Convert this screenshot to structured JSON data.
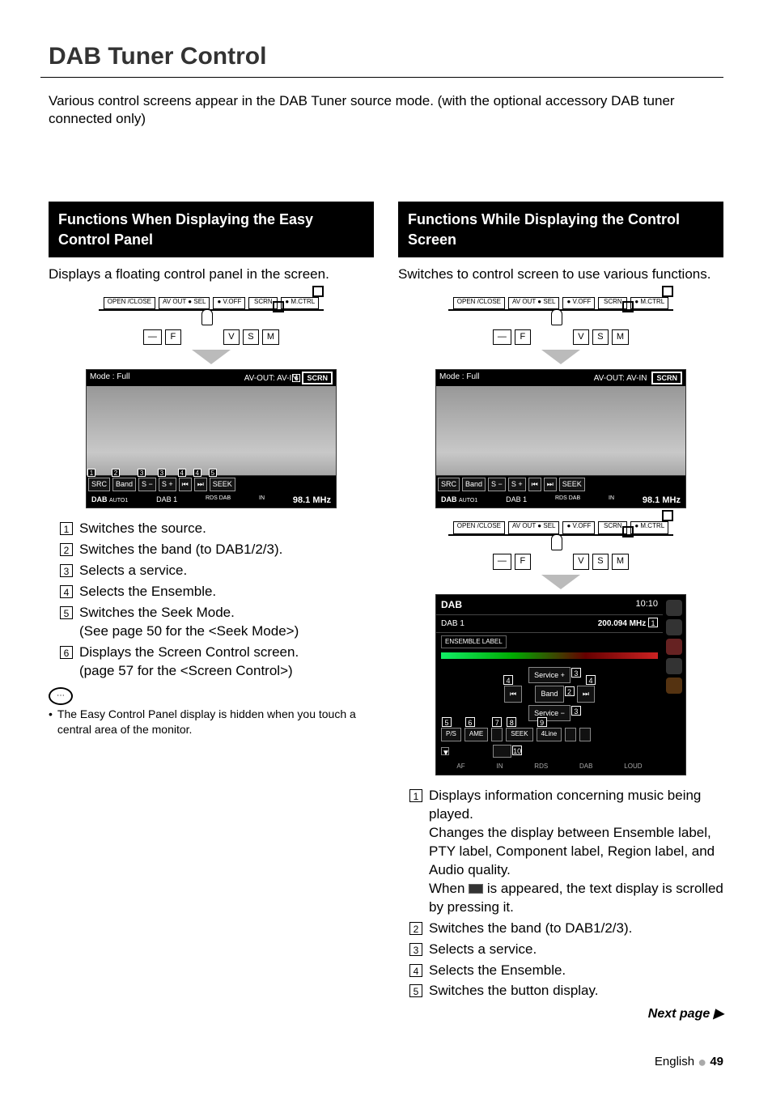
{
  "page": {
    "title": "DAB Tuner Control",
    "intro": "Various control screens appear in the DAB Tuner source mode. (with the optional accessory DAB tuner connected only)",
    "language": "English",
    "number": "49",
    "next_page": "Next page ▶"
  },
  "left": {
    "heading": "Functions When Displaying the Easy Control Panel",
    "desc": "Displays a floating control panel in the screen.",
    "buttons": {
      "open_close": "OPEN\n/CLOSE",
      "av_out_sel": "AV OUT\n● SEL",
      "v_off": "● V.OFF",
      "scrn": "SCRN",
      "mctrl": "● M.CTRL",
      "dash": "—",
      "f": "F",
      "v": "V",
      "s": "S",
      "m": "M"
    },
    "shot": {
      "mode": "Mode : Full",
      "avout": "AV-OUT: AV-IN",
      "scrn": "SCRN",
      "scrn_callout": "6",
      "bar": {
        "src": "SRC",
        "band": "Band",
        "sminus": "S −",
        "splus": "S +",
        "prev": "⏮",
        "next": "⏭",
        "seek": "SEEK",
        "callouts": {
          "src": "1",
          "band": "2",
          "sminus": "3",
          "splus": "3",
          "prev": "4",
          "next": "4",
          "seek": "5"
        }
      },
      "info": {
        "src": "DAB",
        "auto": "AUTO1",
        "preset": "DAB 1",
        "rds": "RDS",
        "dab": "DAB",
        "in": "IN",
        "freq": "98.1 MHz"
      }
    },
    "items": [
      "Switches the source.",
      "Switches the band (to DAB1/2/3).",
      "Selects a service.",
      "Selects the Ensemble.",
      "Switches the Seek Mode.",
      "Displays the Screen Control screen."
    ],
    "subs": {
      "5": "(See page 50 for the <Seek Mode>)",
      "6": "(page 57 for the <Screen Control>)"
    },
    "note_bullet": "•",
    "note": "The Easy Control Panel display is hidden when you touch a central area of the monitor."
  },
  "right": {
    "heading": "Functions While Displaying the Control Screen",
    "desc": "Switches to control screen to use various functions.",
    "buttons": {
      "open_close": "OPEN\n/CLOSE",
      "av_out_sel": "AV OUT\n● SEL",
      "v_off": "● V.OFF",
      "scrn": "SCRN",
      "mctrl": "● M.CTRL",
      "dash": "—",
      "f": "F",
      "v": "V",
      "s": "S",
      "m": "M"
    },
    "shot": {
      "mode": "Mode : Full",
      "avout": "AV-OUT: AV-IN",
      "scrn": "SCRN",
      "bar": {
        "src": "SRC",
        "band": "Band",
        "sminus": "S −",
        "splus": "S +",
        "prev": "⏮",
        "next": "⏭",
        "seek": "SEEK"
      },
      "info": {
        "src": "DAB",
        "auto": "AUTO1",
        "preset": "DAB 1",
        "rds": "RDS",
        "dab": "DAB",
        "in": "IN",
        "freq": "98.1 MHz"
      }
    },
    "ctrl": {
      "title": "DAB",
      "time": "10:10",
      "preset": "DAB 1",
      "freq": "200.094 MHz",
      "freq_callout": "1",
      "ensemble_label": "ENSEMBLE LABEL",
      "service_plus": "Service +",
      "band": "Band",
      "service_minus": "Service −",
      "prev": "⏮",
      "next": "⏭",
      "callouts_mid": {
        "service_plus": "3",
        "band": "2",
        "service_minus": "3",
        "prev": "4",
        "next": "4"
      },
      "bottom": {
        "ps": "P/S",
        "ame": "AME",
        "seek": "SEEK",
        "line4": "4Line",
        "blank1": "",
        "blank2": "",
        "callouts": {
          "ps": "5",
          "ame": "6",
          "seek": "8",
          "line4": "9",
          "first_gap": "7"
        }
      },
      "footer_btn": "",
      "footer_btn_callout": "10",
      "foot": {
        "af": "AF",
        "in": "IN",
        "rds": "RDS",
        "dab": "DAB",
        "loud": "LOUD"
      }
    },
    "items": [
      "Displays information concerning music being played.",
      "Switches the band (to DAB1/2/3).",
      "Selects a service.",
      "Selects the Ensemble.",
      "Switches the button display."
    ],
    "item1_extra": [
      "Changes the display between Ensemble label, PTY label, Component label, Region label, and Audio quality.",
      "When",
      "is appeared, the text display is scrolled by pressing it."
    ]
  }
}
